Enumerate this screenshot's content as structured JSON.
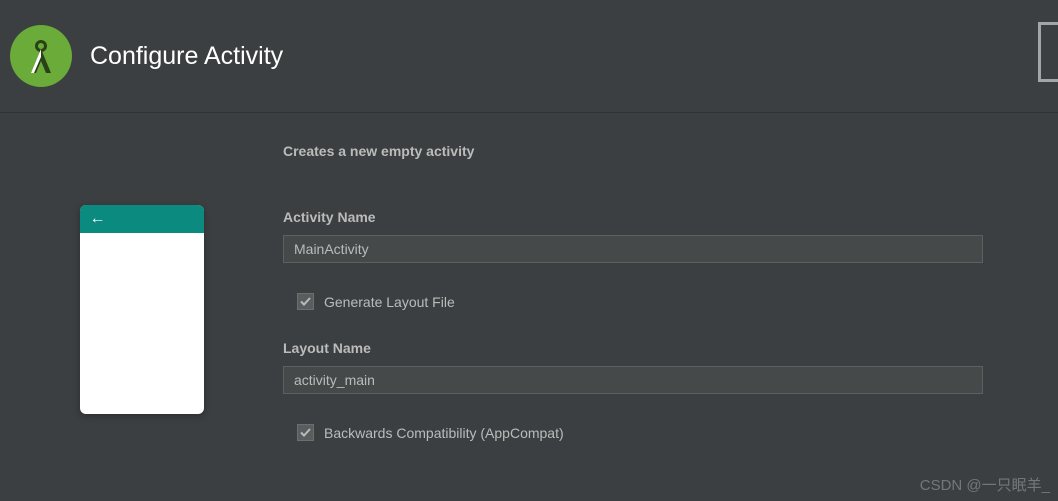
{
  "header": {
    "title": "Configure Activity"
  },
  "form": {
    "description": "Creates a new empty activity",
    "activity_name_label": "Activity Name",
    "activity_name_value": "MainActivity",
    "generate_layout_label": "Generate Layout File",
    "generate_layout_checked": true,
    "layout_name_label": "Layout Name",
    "layout_name_value": "activity_main",
    "backwards_compat_label": "Backwards Compatibility (AppCompat)",
    "backwards_compat_checked": true
  },
  "watermark": "CSDN @一只眠羊_"
}
